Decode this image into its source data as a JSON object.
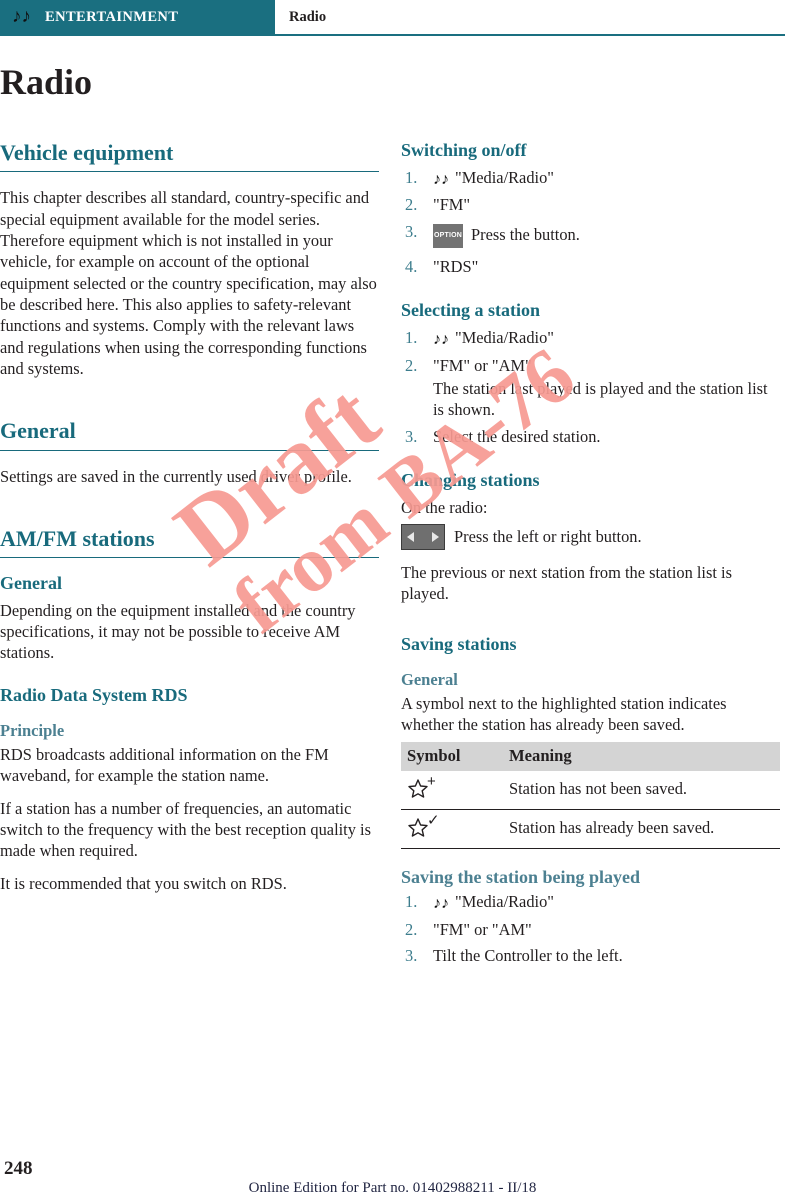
{
  "header": {
    "note_icon": "music-note",
    "chapter": "ENTERTAINMENT",
    "section": "Radio"
  },
  "page_title": "Radio",
  "left_column": {
    "vehicle_equipment": {
      "heading": "Vehicle equipment",
      "body": "This chapter describes all standard, country-specific and special equipment available for the model series. Therefore equipment which is not installed in your vehicle, for example on account of the optional equipment selected or the country specification, may also be described here. This also applies to safety-relevant functions and systems. Comply with the relevant laws and regulations when using the corresponding functions and systems."
    },
    "general": {
      "heading": "General",
      "body": "Settings are saved in the currently used driver profile."
    },
    "am_fm": {
      "heading": "AM/FM stations",
      "general_heading": "General",
      "general_body": "Depending on the equipment installed and the country specifications, it may not be possible to receive AM stations.",
      "rds_heading": "Radio Data System RDS",
      "principle_heading": "Principle",
      "principle_p1": "RDS broadcasts additional information on the FM waveband, for example the station name.",
      "principle_p2": "If a station has a number of frequencies, an automatic switch to the frequency with the best reception quality is made when required.",
      "principle_p3": "It is recommended that you switch on RDS."
    }
  },
  "right_column": {
    "switching": {
      "heading": "Switching on/off",
      "steps": [
        {
          "note_icon": true,
          "text": "\"Media/Radio\""
        },
        {
          "note_icon": false,
          "text": "\"FM\""
        },
        {
          "note_icon": false,
          "key": "OPTION",
          "text": "Press the button."
        },
        {
          "note_icon": false,
          "text": "\"RDS\""
        }
      ]
    },
    "selecting": {
      "heading": "Selecting a station",
      "steps": [
        {
          "note_icon": true,
          "text": "\"Media/Radio\""
        },
        {
          "note_icon": false,
          "text": "\"FM\" or \"AM\"",
          "continuation": "The station last played is played and the station list is shown."
        },
        {
          "note_icon": false,
          "text": "Select the desired station."
        }
      ]
    },
    "changing": {
      "heading": "Changing stations",
      "intro": "On the radio:",
      "key_icon": "left-right-arrow-button",
      "key_text": "Press the left or right button.",
      "result": "The previous or next station from the station list is played."
    },
    "saving": {
      "heading": "Saving stations",
      "general_heading": "General",
      "general_body": "A symbol next to the highlighted station indicates whether the station has already been saved.",
      "table": {
        "columns": [
          "Symbol",
          "Meaning"
        ],
        "rows": [
          {
            "symbol_icon": "star-plus-icon",
            "symbol_mark": "+",
            "meaning": "Station has not been saved."
          },
          {
            "symbol_icon": "star-check-icon",
            "symbol_mark": "✓",
            "meaning": "Station has already been saved."
          }
        ]
      }
    },
    "saving_played": {
      "heading": "Saving the station being played",
      "steps": [
        {
          "note_icon": true,
          "text": "\"Media/Radio\""
        },
        {
          "note_icon": false,
          "text": "\"FM\" or \"AM\""
        },
        {
          "note_icon": false,
          "text": "Tilt the Controller to the left."
        }
      ]
    }
  },
  "watermark": {
    "line1": "Draft",
    "line2": "from BA-76",
    "color": "#f79a92"
  },
  "footer": {
    "page_number": "248",
    "note": "Online Edition for Part no. 01402988211 - II/18"
  },
  "colors": {
    "teal": "#1a6f80",
    "heading": "#186a7c",
    "subsub": "#4c8091",
    "table_header_bg": "#d4d4d4",
    "key_gray": "#737373"
  }
}
